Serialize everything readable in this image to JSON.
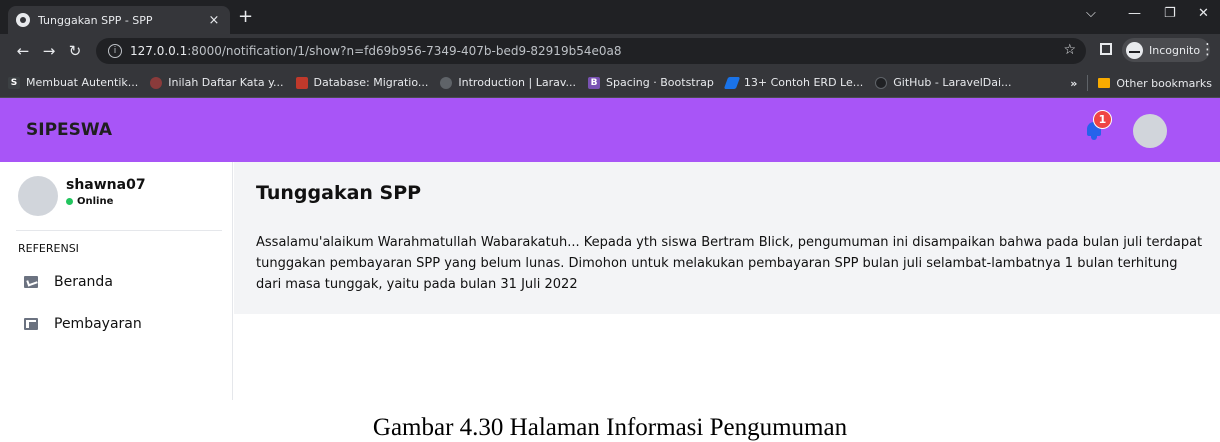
{
  "browser": {
    "tab_title": "Tunggakan SPP - SPP",
    "tab_close": "×",
    "new_tab": "+",
    "window_controls": [
      "⌵",
      "—",
      "❐",
      "✕"
    ],
    "url_host": "127.0.0.1",
    "url_rest": ":8000/notification/1/show?n=fd69b956-7349-407b-bed9-82919b54e0a8",
    "incognito_label": "Incognito",
    "bookmarks": [
      {
        "label": "Membuat Autentik...",
        "icon": "S",
        "color": "#3c4043"
      },
      {
        "label": "Inilah Daftar Kata y...",
        "icon": "",
        "color": "#8a3b3b"
      },
      {
        "label": "Database: Migratio...",
        "icon": "",
        "color": "#c0392b"
      },
      {
        "label": "Introduction | Larav...",
        "icon": "",
        "color": "#5f6368"
      },
      {
        "label": "Spacing · Bootstrap",
        "icon": "B",
        "color": "#7952b3"
      },
      {
        "label": "13+ Contoh ERD Le...",
        "icon": "",
        "color": "#1a73e8"
      },
      {
        "label": "GitHub - LaravelDai...",
        "icon": "",
        "color": "#202124"
      }
    ],
    "more_bookmarks": "»",
    "other_bookmarks": "Other bookmarks"
  },
  "app": {
    "brand": "SIPESWA",
    "notification_count": "1",
    "sidebar": {
      "username": "shawna07",
      "status": "Online",
      "section_label": "REFERENSI",
      "items": [
        {
          "label": "Beranda"
        },
        {
          "label": "Pembayaran"
        }
      ]
    },
    "notification": {
      "title": "Tunggakan SPP",
      "body": "Assalamu'alaikum Warahmatullah Wabarakatuh... Kepada yth siswa Bertram Blick, pengumuman ini disampaikan bahwa pada bulan juli terdapat tunggakan pembayaran SPP yang belum lunas. Dimohon untuk melakukan pembayaran SPP bulan juli selambat-lambatnya 1 bulan terhitung dari masa tunggak, yaitu pada bulan 31 Juli 2022"
    }
  },
  "caption": "Gambar 4.30 Halaman Informasi Pengumuman"
}
